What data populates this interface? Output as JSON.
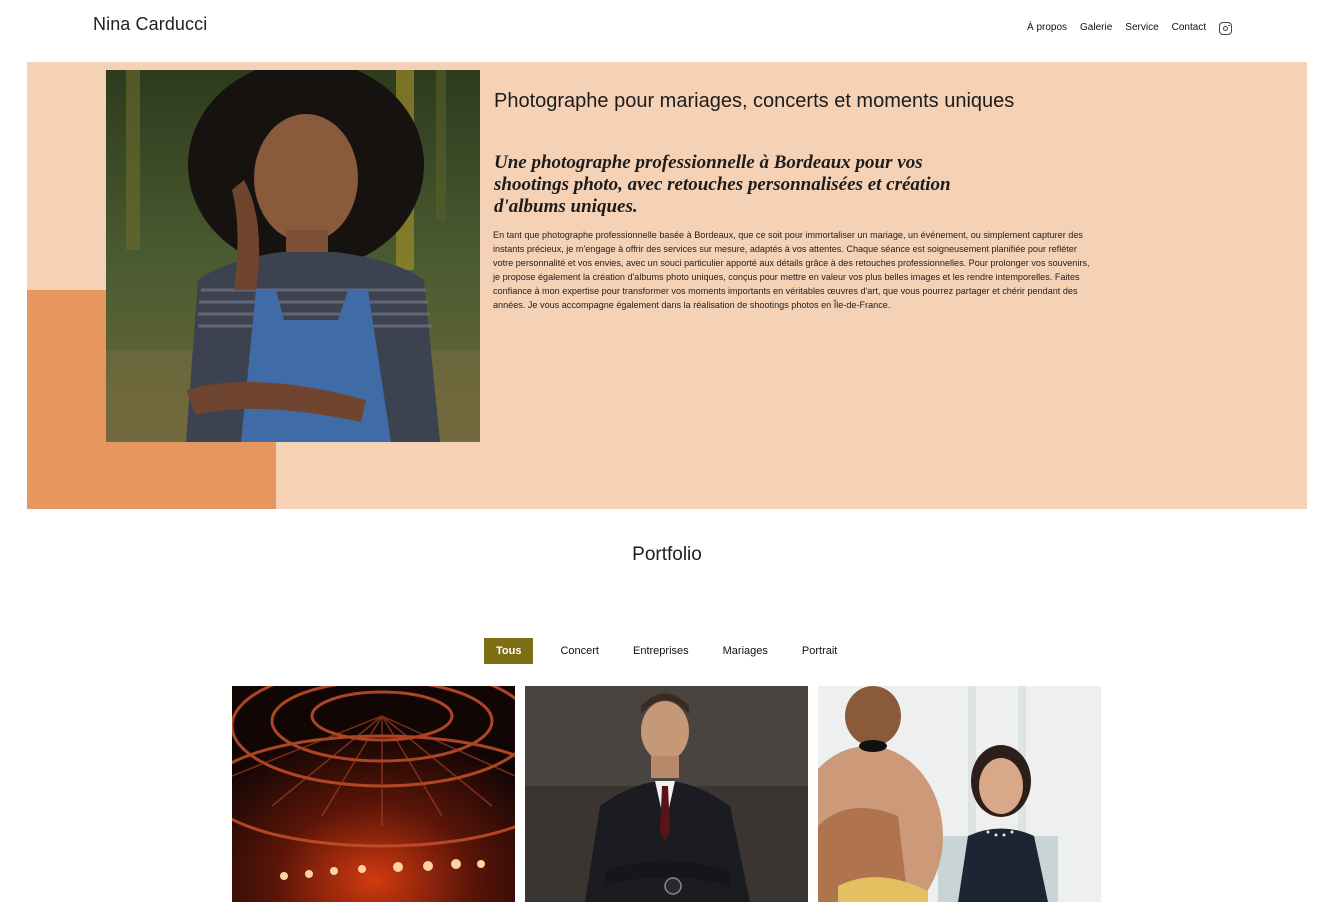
{
  "header": {
    "brand": "Nina Carducci",
    "nav": [
      {
        "label": "À propos"
      },
      {
        "label": "Galerie"
      },
      {
        "label": "Service"
      },
      {
        "label": "Contact"
      }
    ],
    "social_icon": "instagram-icon"
  },
  "hero": {
    "heading": "Photographe pour mariages, concerts et moments uniques",
    "subheading": "Une photographe professionnelle à Bordeaux pour vos shootings photo, avec retouches personnalisées et création d'albums uniques.",
    "body": "En tant que photographe professionnelle basée à Bordeaux, que ce soit pour immortaliser un mariage, un événement, ou simplement capturer des instants précieux, je m'engage à offrir des services sur mesure, adaptés à vos attentes. Chaque séance est soigneusement planifiée pour refléter votre personnalité et vos envies, avec un souci particulier apporté aux détails grâce à des retouches professionnelles. Pour prolonger vos souvenirs, je propose également la création d'albums photo uniques, conçus pour mettre en valeur vos plus belles images et les rendre intemporelles. Faites confiance à mon expertise pour transformer vos moments importants en véritables œuvres d'art, que vous pourrez partager et chérir pendant des années. Je vous accompagne également dans la réalisation de shootings photos en Île-de-France.",
    "colors": {
      "background": "#f5d1b6",
      "accent": "#e5975f"
    }
  },
  "portfolio": {
    "title": "Portfolio",
    "filters": [
      {
        "label": "Tous",
        "active": true
      },
      {
        "label": "Concert",
        "active": false
      },
      {
        "label": "Entreprises",
        "active": false
      },
      {
        "label": "Mariages",
        "active": false
      },
      {
        "label": "Portrait",
        "active": false
      }
    ],
    "active_color": "#7e6e14"
  }
}
